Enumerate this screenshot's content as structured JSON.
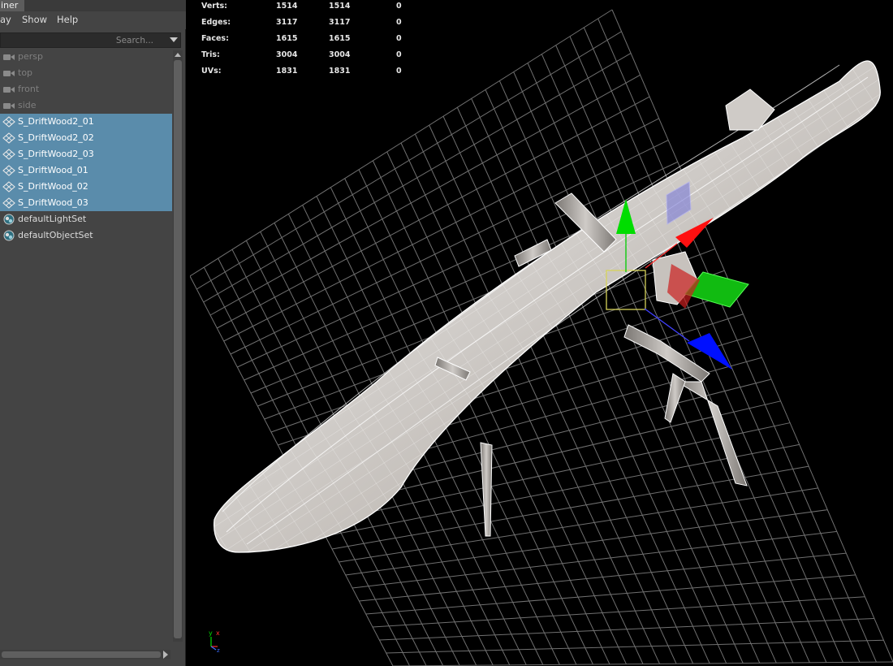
{
  "outliner": {
    "tab_label": "iner",
    "menu": [
      "ay",
      "Show",
      "Help"
    ],
    "search_placeholder": "Search...",
    "items": [
      {
        "label": "persp",
        "type": "camera",
        "icon": "camera-icon",
        "selected": false
      },
      {
        "label": "top",
        "type": "camera",
        "icon": "camera-icon",
        "selected": false
      },
      {
        "label": "front",
        "type": "camera",
        "icon": "camera-icon",
        "selected": false
      },
      {
        "label": "side",
        "type": "camera",
        "icon": "camera-icon",
        "selected": false
      },
      {
        "label": "S_DriftWood2_01",
        "type": "mesh",
        "icon": "mesh-icon",
        "selected": true
      },
      {
        "label": "S_DriftWood2_02",
        "type": "mesh",
        "icon": "mesh-icon",
        "selected": true
      },
      {
        "label": "S_DriftWood2_03",
        "type": "mesh",
        "icon": "mesh-icon",
        "selected": true
      },
      {
        "label": "S_DriftWood_01",
        "type": "mesh",
        "icon": "mesh-icon",
        "selected": true
      },
      {
        "label": "S_DriftWood_02",
        "type": "mesh",
        "icon": "mesh-icon",
        "selected": true
      },
      {
        "label": "S_DriftWood_03",
        "type": "mesh",
        "icon": "mesh-icon",
        "selected": true
      },
      {
        "label": "defaultLightSet",
        "type": "set",
        "icon": "set-icon",
        "selected": false
      },
      {
        "label": "defaultObjectSet",
        "type": "set",
        "icon": "set-icon",
        "selected": false
      }
    ]
  },
  "hud": {
    "rows": [
      {
        "label": "Verts:",
        "v1": "1514",
        "v2": "1514",
        "v3": "0"
      },
      {
        "label": "Edges:",
        "v1": "3117",
        "v2": "3117",
        "v3": "0"
      },
      {
        "label": "Faces:",
        "v1": "1615",
        "v2": "1615",
        "v3": "0"
      },
      {
        "label": "Tris:",
        "v1": "3004",
        "v2": "3004",
        "v3": "0"
      },
      {
        "label": "UVs:",
        "v1": "1831",
        "v2": "1831",
        "v3": "0"
      }
    ]
  },
  "viewport": {
    "axis_labels": {
      "y": "y",
      "x": "x",
      "z": "z"
    },
    "colors": {
      "selection": "#5a8cab",
      "manipulator_x": "#ff0000",
      "manipulator_y": "#00cc00",
      "manipulator_z": "#0000ff",
      "grid": "#6a6a6a"
    }
  }
}
